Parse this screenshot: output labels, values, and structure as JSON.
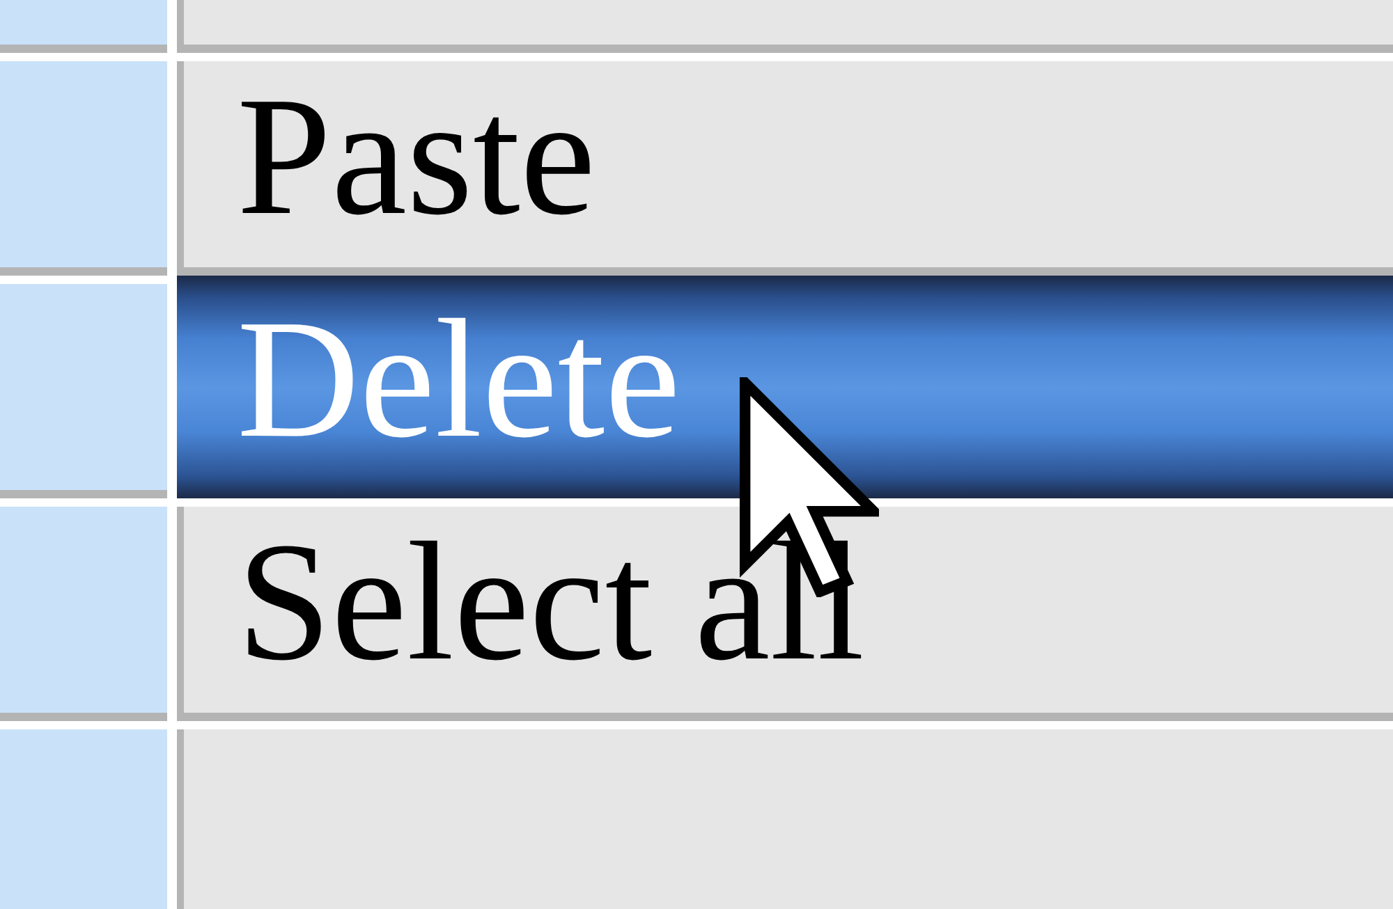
{
  "menu": {
    "items": [
      {
        "kind": "cut",
        "selected": false
      },
      {
        "kind": "item",
        "label": "Paste",
        "selected": false
      },
      {
        "kind": "item",
        "label": "Delete",
        "selected": true
      },
      {
        "kind": "item",
        "label": "Select all",
        "selected": false
      },
      {
        "kind": "cut",
        "selected": false
      }
    ]
  }
}
